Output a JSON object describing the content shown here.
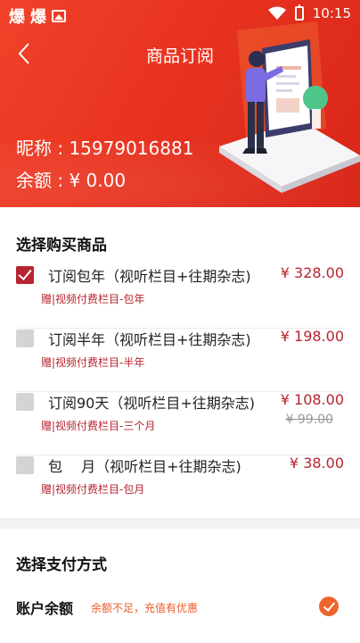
{
  "status_bar": {
    "left_glyphs": [
      "爆",
      "爆"
    ],
    "icons": [
      "image-icon",
      "wifi-icon",
      "battery-icon"
    ],
    "time": "10:15"
  },
  "header": {
    "title": "商品订阅",
    "back_icon": "chevron-left-icon",
    "nickname": "昵称 : 15979016881",
    "balance": "余额 : ¥ 0.00",
    "colors": {
      "gradient_start": "#f0422a",
      "gradient_end": "#d8261a"
    }
  },
  "products": {
    "section_title": "选择购买商品",
    "items": [
      {
        "name": "订阅包年（视听栏目+往期杂志)",
        "price": "¥ 328.00",
        "original_price": "",
        "gift": "赠|视频付费栏目-包年",
        "checked": true
      },
      {
        "name": "订阅半年（视听栏目+往期杂志)",
        "price": "¥ 198.00",
        "original_price": "",
        "gift": "赠|视频付费栏目-半年",
        "checked": false
      },
      {
        "name": "订阅90天（视听栏目+往期杂志)",
        "price": "¥ 108.00",
        "original_price": "¥ 99.00",
        "gift": "赠|视频付费栏目-三个月",
        "checked": false
      },
      {
        "name": "包　 月（视听栏目+往期杂志)",
        "price": "¥ 38.00",
        "original_price": "",
        "gift": "赠|视频付费栏目-包月",
        "checked": false
      }
    ],
    "accent_color": "#b7242f"
  },
  "payment": {
    "section_title": "选择支付方式",
    "method_label": "账户余额",
    "method_hint": "余额不足，充值有优惠",
    "selected": true,
    "check_color": "#f0642d"
  }
}
